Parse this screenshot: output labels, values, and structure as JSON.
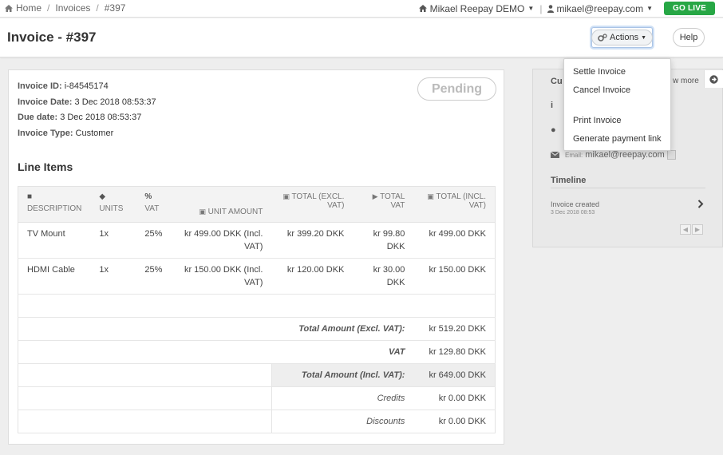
{
  "breadcrumb": {
    "home": "Home",
    "invoices": "Invoices",
    "current": "#397",
    "sep": "/"
  },
  "topnav": {
    "account": "Mikael Reepay DEMO",
    "user": "mikael@reepay.com",
    "go_live": "GO LIVE",
    "vsep": "|"
  },
  "header": {
    "title": "Invoice - #397",
    "actions_label": "Actions",
    "help_label": "Help"
  },
  "invoice": {
    "id_label": "Invoice ID:",
    "id": "i-84545174",
    "date_label": "Invoice Date:",
    "date": "3 Dec 2018 08:53:37",
    "due_label": "Due date:",
    "due": "3 Dec 2018 08:53:37",
    "type_label": "Invoice Type:",
    "type": "Customer",
    "status": "Pending"
  },
  "line_items": {
    "title": "Line Items",
    "headers": {
      "description": "DESCRIPTION",
      "units": "UNITS",
      "vat": "VAT",
      "unit_amount": "UNIT AMOUNT",
      "total_excl": "TOTAL (EXCL. VAT)",
      "total_vat": "TOTAL VAT",
      "total_incl": "TOTAL (INCL. VAT)"
    },
    "rows": [
      {
        "description": "TV Mount",
        "units": "1x",
        "vat": "25%",
        "unit_amount": "kr 499.00 DKK (Incl. VAT)",
        "total_excl": "kr 399.20 DKK",
        "total_vat": "kr 99.80 DKK",
        "total_incl": "kr 499.00 DKK"
      },
      {
        "description": "HDMI Cable",
        "units": "1x",
        "vat": "25%",
        "unit_amount": "kr 150.00 DKK (Incl. VAT)",
        "total_excl": "kr 120.00 DKK",
        "total_vat": "kr 30.00 DKK",
        "total_incl": "kr 150.00 DKK"
      }
    ],
    "totals": {
      "excl_label": "Total Amount (Excl. VAT):",
      "excl": "kr 519.20 DKK",
      "vat_label": "VAT",
      "vat": "kr 129.80 DKK",
      "incl_label": "Total Amount (Incl. VAT):",
      "incl": "kr 649.00 DKK",
      "credits_label": "Credits",
      "credits": "kr 0.00 DKK",
      "discounts_label": "Discounts",
      "discounts": "kr 0.00 DKK"
    }
  },
  "customer_panel": {
    "title": "Cu",
    "show_more": "w more",
    "email_label": "Email:",
    "email": "mikael@reepay.com",
    "timeline_title": "Timeline",
    "timeline_item": "Invoice created",
    "timeline_date": "3 Dec 2018 08:53"
  },
  "actions_menu": {
    "items": [
      "Settle Invoice",
      "Cancel Invoice",
      "Print Invoice",
      "Generate payment link"
    ]
  },
  "colors": {
    "go_live": "#27a745",
    "focus_ring": "#cfe0f5"
  }
}
